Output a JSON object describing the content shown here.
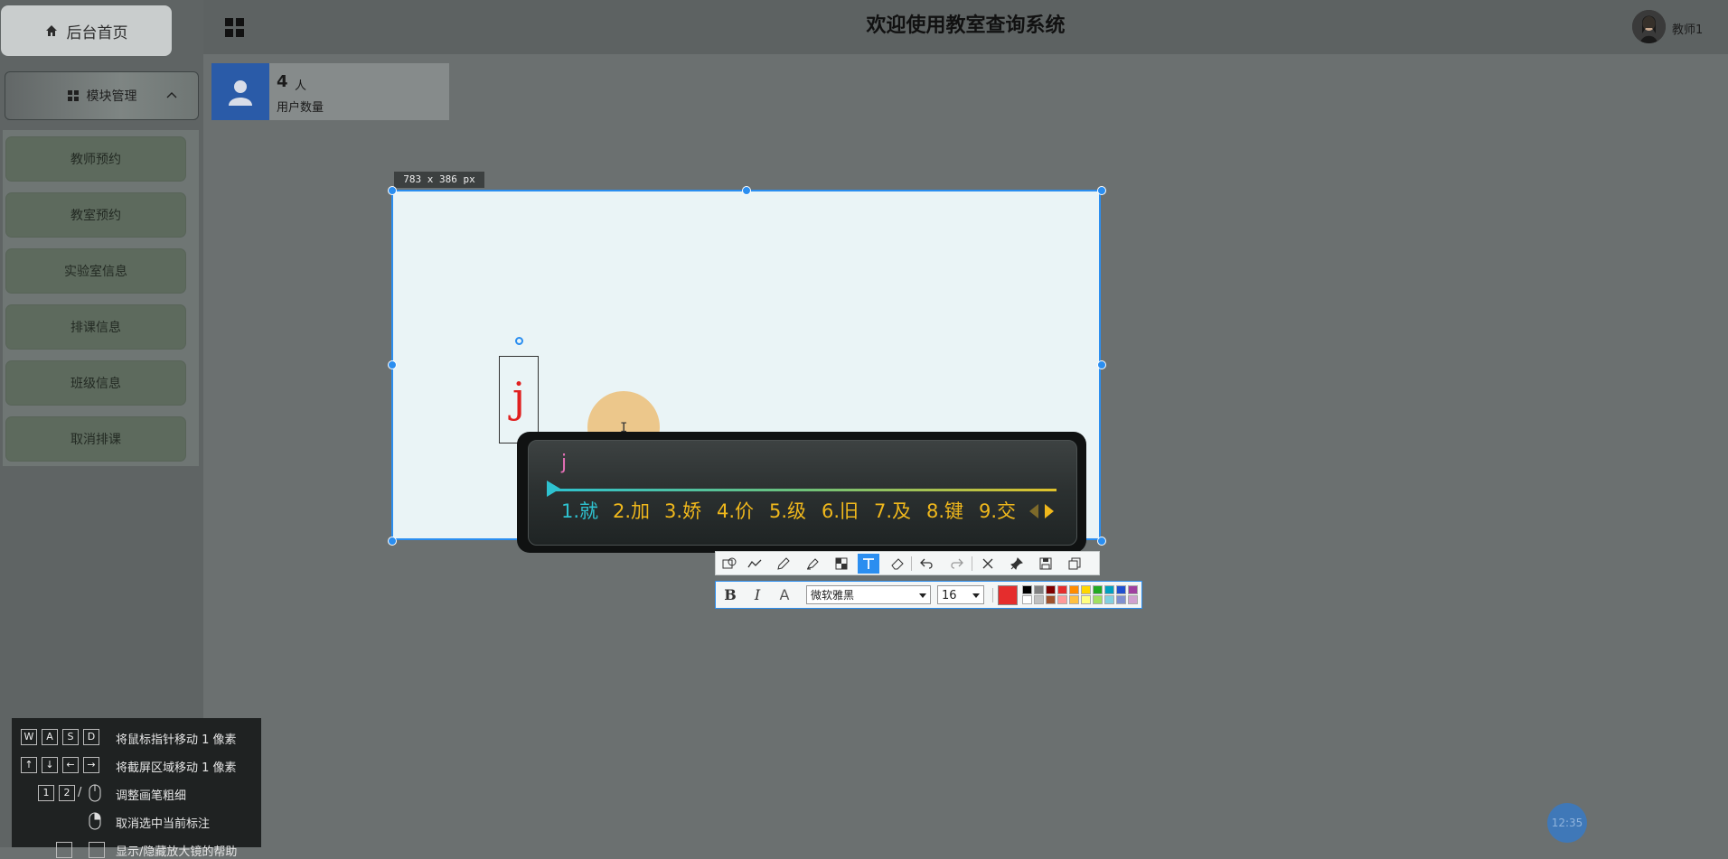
{
  "sidebar": {
    "home_label": "后台首页",
    "module_label": "模块管理",
    "items": [
      {
        "label": "教师预约"
      },
      {
        "label": "教室预约"
      },
      {
        "label": "实验室信息"
      },
      {
        "label": "排课信息"
      },
      {
        "label": "班级信息"
      },
      {
        "label": "取消排课"
      }
    ]
  },
  "header": {
    "title": "欢迎使用教室查询系统",
    "username": "教师1"
  },
  "stat_card": {
    "count": "4",
    "unit": "人",
    "label": "用户数量"
  },
  "capture": {
    "size_label": "783 x 386  px",
    "text_char": "j"
  },
  "ime": {
    "composition": "j",
    "candidates": [
      "1.就",
      "2.加",
      "3.娇",
      "4.价",
      "5.级",
      "6.旧",
      "7.及",
      "8.键",
      "9.交"
    ]
  },
  "textbar": {
    "bold": "B",
    "italic": "I",
    "outline": "A",
    "font": "微软雅黑",
    "size": "16",
    "current_color": "#e52d2d",
    "palette_top": [
      "#000000",
      "#808080",
      "#800000",
      "#e52d2d",
      "#ff8c00",
      "#ffd700",
      "#22aa22",
      "#00a0c0",
      "#2050d0",
      "#a040a0"
    ],
    "palette_bottom": [
      "#ffffff",
      "#c0c0c0",
      "#a0522d",
      "#ff9999",
      "#ffc040",
      "#ffff80",
      "#a0e060",
      "#80d0e0",
      "#8090d0",
      "#d0a0d0"
    ]
  },
  "shortcuts": {
    "keys_row1": [
      "W",
      "A",
      "S",
      "D"
    ],
    "row1_text": "将鼠标指针移动 1 像素",
    "keys_row2": [
      "↑",
      "↓",
      "←",
      "→"
    ],
    "row2_text": "将截屏区域移动 1 像素",
    "keys_row3": [
      "1",
      "2"
    ],
    "row3_sep": "/",
    "row3_text": "调整画笔粗细",
    "row4_text": "取消选中当前标注",
    "row5_text": "显示/隐藏放大镜的帮助"
  },
  "clock": "12:35"
}
